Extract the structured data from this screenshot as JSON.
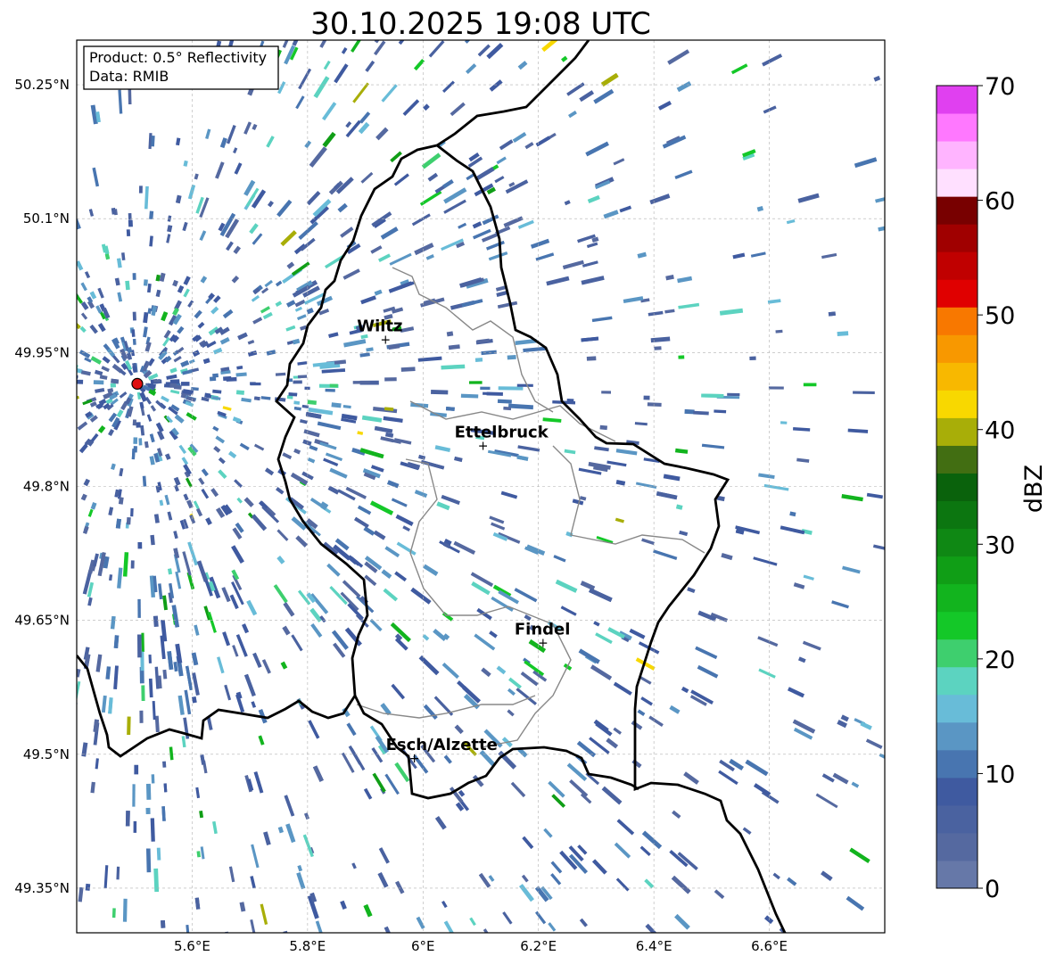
{
  "title": "30.10.2025 19:08 UTC",
  "info_box": {
    "line1": "Product: 0.5° Reflectivity",
    "line2": "Data: RMIB"
  },
  "map": {
    "lon_range": [
      5.4,
      6.8
    ],
    "lat_range": [
      49.3,
      50.3
    ],
    "x_ticks": [
      {
        "value": 5.6,
        "label": "5.6°E"
      },
      {
        "value": 5.8,
        "label": "5.8°E"
      },
      {
        "value": 6.0,
        "label": "6°E"
      },
      {
        "value": 6.2,
        "label": "6.2°E"
      },
      {
        "value": 6.4,
        "label": "6.4°E"
      },
      {
        "value": 6.6,
        "label": "6.6°E"
      }
    ],
    "y_ticks": [
      {
        "value": 50.25,
        "label": "50.25°N"
      },
      {
        "value": 50.1,
        "label": "50.1°N"
      },
      {
        "value": 49.95,
        "label": "49.95°N"
      },
      {
        "value": 49.8,
        "label": "49.8°N"
      },
      {
        "value": 49.65,
        "label": "49.65°N"
      },
      {
        "value": 49.5,
        "label": "49.5°N"
      },
      {
        "value": 49.35,
        "label": "49.35°N"
      }
    ],
    "grid": true,
    "radar_site": {
      "lon": 5.505,
      "lat": 49.915,
      "color": "#e01010"
    },
    "cities": [
      {
        "name": "Wiltz",
        "lon": 5.935,
        "lat": 49.966
      },
      {
        "name": "Ettelbruck",
        "lon": 6.104,
        "lat": 49.847
      },
      {
        "name": "Findel",
        "lon": 6.208,
        "lat": 49.626
      },
      {
        "name": "Esch/Alzette",
        "lon": 5.985,
        "lat": 49.497
      }
    ]
  },
  "colorbar": {
    "label": "dBZ",
    "min": 0,
    "max": 70,
    "ticks": [
      {
        "value": 0,
        "label": "0"
      },
      {
        "value": 10,
        "label": "10"
      },
      {
        "value": 20,
        "label": "20"
      },
      {
        "value": 30,
        "label": "30"
      },
      {
        "value": 40,
        "label": "40"
      },
      {
        "value": 50,
        "label": "50"
      },
      {
        "value": 60,
        "label": "60"
      },
      {
        "value": 70,
        "label": "70"
      }
    ],
    "colors": [
      "#6678a8",
      "#5569a0",
      "#4a62a0",
      "#3f5aa0",
      "#4875b0",
      "#5a96c4",
      "#68bcd8",
      "#5cd3c0",
      "#3ecf6e",
      "#14c828",
      "#12b41e",
      "#109e16",
      "#0f8814",
      "#0c7610",
      "#0a620c",
      "#426e12",
      "#a8ae08",
      "#f8d800",
      "#f8b800",
      "#f89800",
      "#f87800",
      "#e00000",
      "#c00000",
      "#a00000",
      "#780000",
      "#ffe0ff",
      "#ffb4ff",
      "#ff78ff",
      "#e040f0"
    ]
  }
}
